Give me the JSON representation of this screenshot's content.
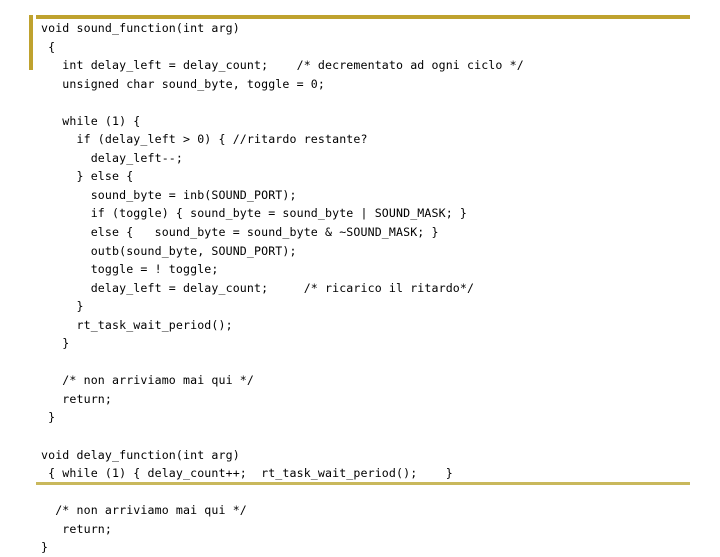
{
  "slide": {
    "type": "code-slide",
    "language": "c",
    "background_color": "#ffffff",
    "text_color": "#000000",
    "accent_color_top": "#bfa22e",
    "accent_color_bottom": "#c9b85c"
  },
  "decoration": {
    "top_rule_label": "top-gold-rule",
    "left_rule_label": "left-gold-rule",
    "bottom_rule_label": "bottom-gold-rule"
  },
  "code": {
    "lines": [
      "void sound_function(int arg)",
      " {",
      "   int delay_left = delay_count;    /* decrementato ad ogni ciclo */",
      "   unsigned char sound_byte, toggle = 0;",
      "",
      "   while (1) {",
      "     if (delay_left > 0) { //ritardo restante?",
      "       delay_left--;",
      "     } else {",
      "       sound_byte = inb(SOUND_PORT);",
      "       if (toggle) { sound_byte = sound_byte | SOUND_MASK; }",
      "       else {   sound_byte = sound_byte & ~SOUND_MASK; }",
      "       outb(sound_byte, SOUND_PORT);",
      "       toggle = ! toggle;",
      "       delay_left = delay_count;     /* ricarico il ritardo*/",
      "     }",
      "     rt_task_wait_period();",
      "   }",
      "",
      "   /* non arriviamo mai qui */",
      "   return;",
      " }",
      "",
      "void delay_function(int arg)",
      " { while (1) { delay_count++;  rt_task_wait_period();    }",
      "",
      "  /* non arriviamo mai qui */",
      "   return;",
      "}"
    ]
  }
}
